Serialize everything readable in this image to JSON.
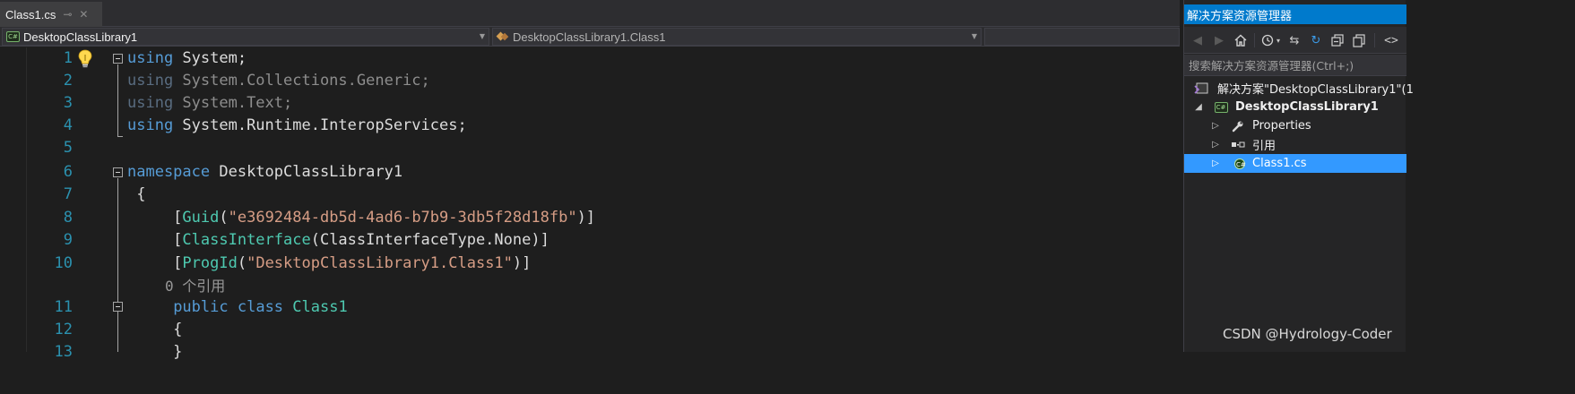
{
  "document_tab": {
    "title": "Class1.cs",
    "pin_glyph": "⊸",
    "close_glyph": "✕"
  },
  "nav_bar": {
    "project_combo": "DesktopClassLibrary1",
    "type_combo": "DesktopClassLibrary1.Class1",
    "member_combo": ""
  },
  "code": {
    "line_numbers": [
      "1",
      "2",
      "3",
      "4",
      "5",
      "6",
      "7",
      "8",
      "9",
      "10",
      "11",
      "12",
      "13"
    ],
    "l1": {
      "kw": "using",
      "rest": " System;"
    },
    "l2": {
      "kw": "using",
      "rest": " System.Collections.Generic;"
    },
    "l3": {
      "kw": "using",
      "rest": " System.Text;"
    },
    "l4": {
      "kw": "using",
      "rest": " System.Runtime.InteropServices;"
    },
    "l6": {
      "kw": "namespace",
      "rest": " DesktopClassLibrary1"
    },
    "l7": {
      "text": " {"
    },
    "l8": {
      "lead": "     [",
      "type": "Guid",
      "open": "(",
      "str": "\"e3692484-db5d-4ad6-b7b9-3db5f28d18fb\"",
      "close": ")]"
    },
    "l9": {
      "lead": "     [",
      "type": "ClassInterface",
      "mid": "(ClassInterfaceType.None)]"
    },
    "l10": {
      "lead": "     [",
      "type": "ProgId",
      "open": "(",
      "str": "\"DesktopClassLibrary1.Class1\"",
      "close": ")]"
    },
    "codelens": "0 个引用",
    "l11": {
      "lead": "     ",
      "kw1": "public",
      "sp": " ",
      "kw2": "class",
      "sp2": " ",
      "type": "Class1"
    },
    "l12": {
      "text": "     {"
    },
    "l13": {
      "text": "     }"
    }
  },
  "solution_explorer": {
    "title": "解决方案资源管理器",
    "search_placeholder": "搜索解决方案资源管理器(Ctrl+;)",
    "toolbar_icons": [
      "back-icon",
      "forward-icon",
      "home-icon",
      "history-icon",
      "sync-icon",
      "refresh-icon",
      "collapse-all-icon",
      "copy-icon",
      "code-icon"
    ],
    "tree": [
      {
        "label": "解决方案\"DesktopClassLibrary1\"(1",
        "icon": "solution-icon"
      },
      {
        "label": "DesktopClassLibrary1",
        "icon": "csharp-project-icon"
      },
      {
        "label": "Properties",
        "icon": "wrench-icon"
      },
      {
        "label": "引用",
        "icon": "references-icon"
      },
      {
        "label": "Class1.cs",
        "icon": "csharp-file-icon"
      }
    ]
  },
  "watermark": "CSDN @Hydrology-Coder",
  "colors": {
    "background": "#1e1e1e",
    "keyword": "#569cd6",
    "type": "#4ec9b0",
    "string": "#d69d85",
    "line_number": "#2b91af",
    "selection": "#3399ff",
    "accent": "#007acc"
  }
}
